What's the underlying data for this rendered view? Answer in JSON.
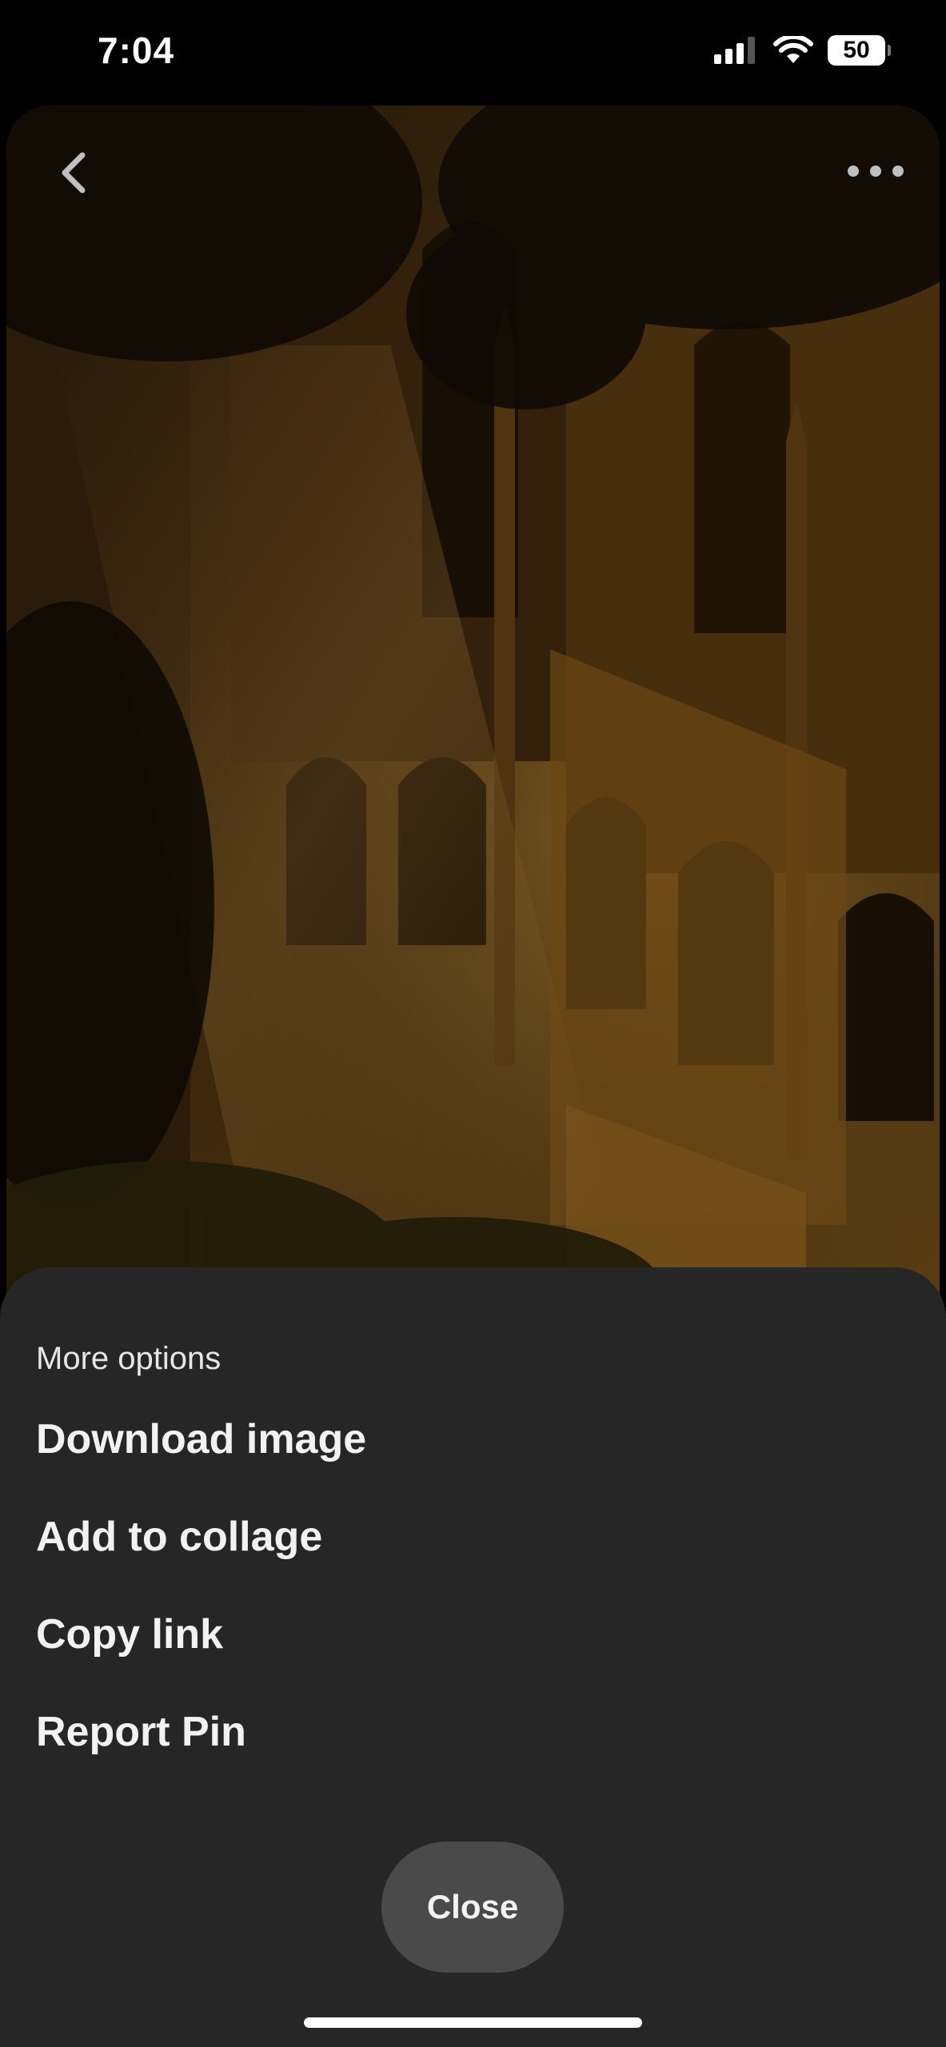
{
  "status_bar": {
    "time": "7:04",
    "battery_level": "50",
    "signal_icon": "cellular-signal-icon",
    "wifi_icon": "wifi-icon"
  },
  "pin": {
    "back_icon": "chevron-left-icon",
    "more_icon": "ellipsis-icon"
  },
  "sheet": {
    "title": "More options",
    "options": [
      "Download image",
      "Add to collage",
      "Copy link",
      "Report Pin"
    ],
    "close_label": "Close"
  },
  "colors": {
    "sheet_background": "#262626",
    "close_button": "#4a4a4a",
    "text": "#f2f2f2"
  }
}
